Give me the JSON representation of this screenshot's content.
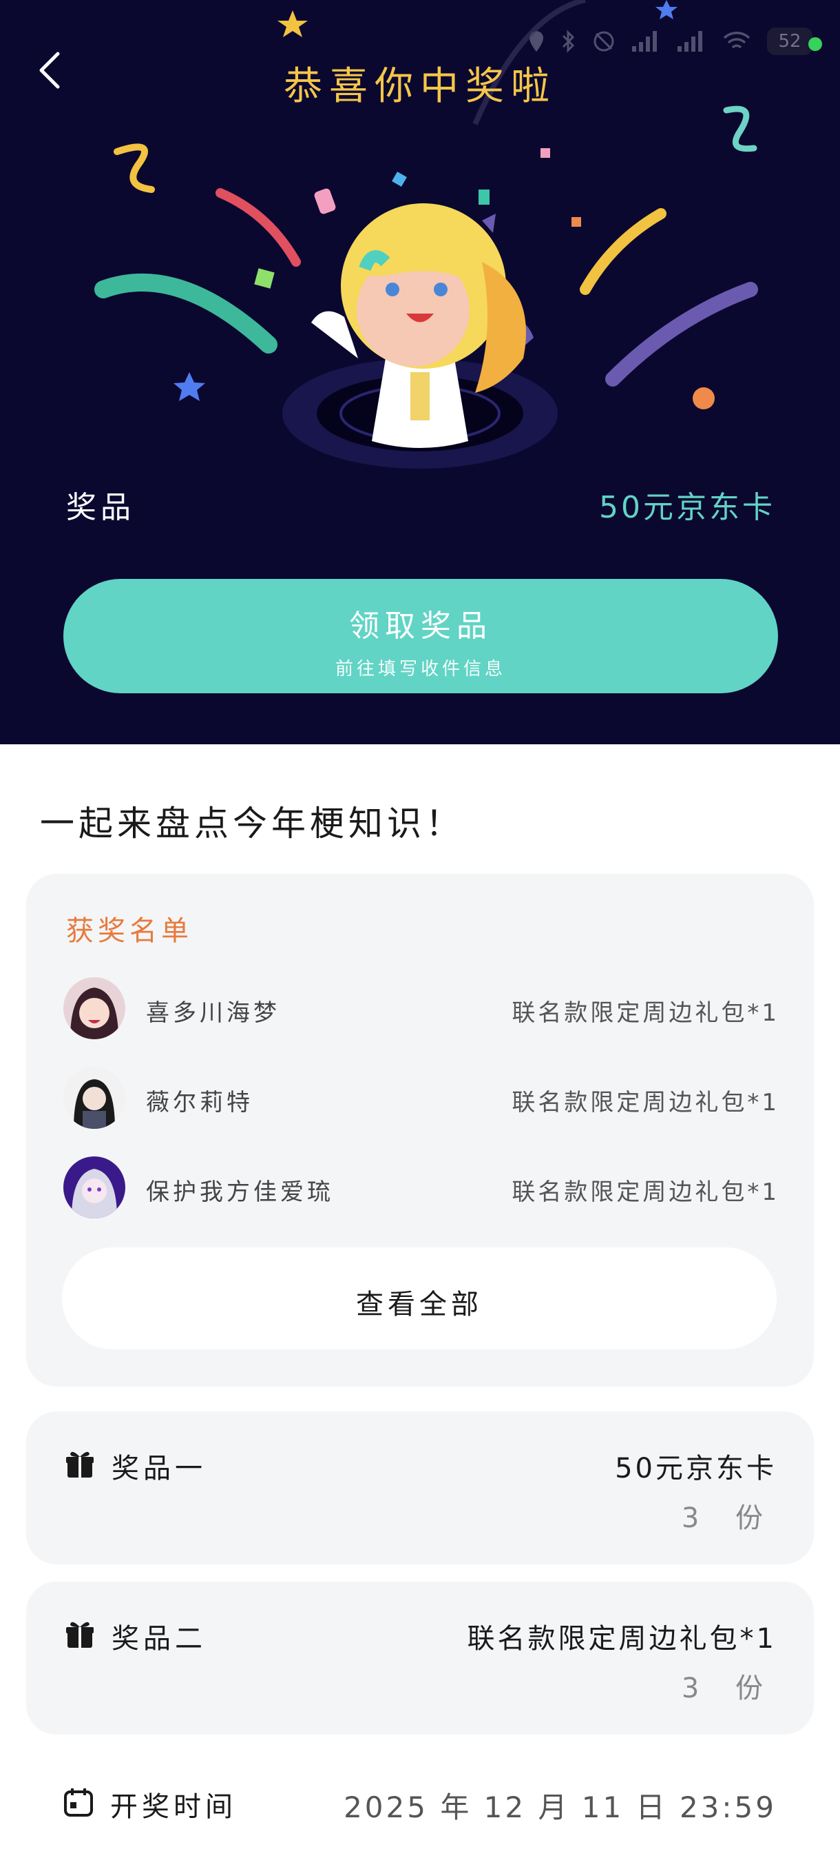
{
  "status_bar": {
    "battery": "52"
  },
  "header": {
    "title": "恭喜你中奖啦"
  },
  "prize": {
    "label": "奖品",
    "value": "50元京东卡"
  },
  "claim_button": {
    "label": "领取奖品",
    "sub_label": "前往填写收件信息"
  },
  "section": {
    "title": "一起来盘点今年梗知识！"
  },
  "winners": {
    "title": "获奖名单",
    "items": [
      {
        "name": "喜多川海梦",
        "prize": "联名款限定周边礼包*1"
      },
      {
        "name": "薇尔莉特",
        "prize": "联名款限定周边礼包*1"
      },
      {
        "name": "保护我方佳爱琉",
        "prize": "联名款限定周边礼包*1"
      }
    ],
    "view_all": "查看全部"
  },
  "prizes": [
    {
      "label": "奖品一",
      "value": "50元京东卡",
      "count": "3 份"
    },
    {
      "label": "奖品二",
      "value": "联名款限定周边礼包*1",
      "count": "3 份"
    }
  ],
  "draw_time": {
    "label": "开奖时间",
    "value": "2025 年 12 月 11 日 23:59"
  },
  "colors": {
    "hero_bg": "#0b0830",
    "accent_teal": "#61d4c5",
    "title_gold": "#f4c64a",
    "winners_orange": "#e77a3d"
  }
}
